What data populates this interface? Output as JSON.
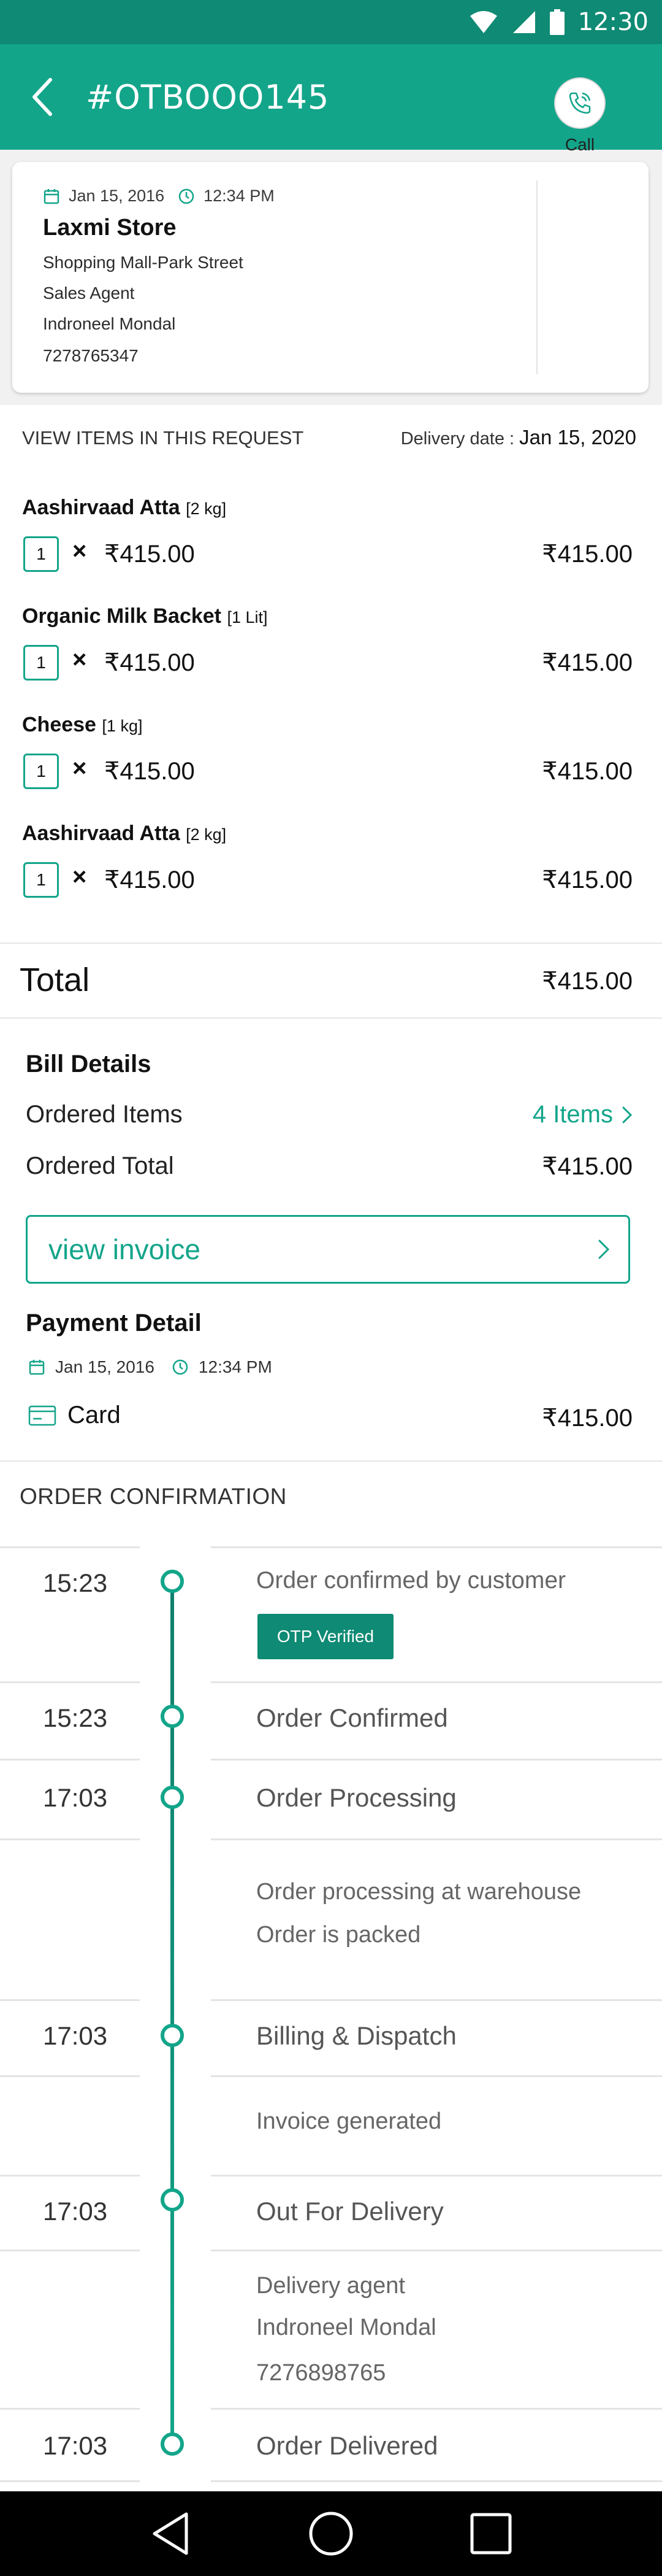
{
  "status_bar": {
    "time": "12:30"
  },
  "header": {
    "title": "#OTBOOO145"
  },
  "store": {
    "date": "Jan 15, 2016",
    "time": "12:34 PM",
    "name": "Laxmi Store",
    "address": "Shopping Mall-Park Street",
    "role": "Sales Agent",
    "agent": "Indroneel Mondal",
    "phone": "7278765347",
    "call_label": "Call"
  },
  "items_section": {
    "heading": "VIEW ITEMS IN THIS REQUEST",
    "delivery_label": "Delivery date :",
    "delivery_date": "Jan 15, 2020"
  },
  "items": [
    {
      "name": "Aashirvaad Atta",
      "size": "[2 kg]",
      "qty": "1",
      "times": "×",
      "unit_price": "₹415.00",
      "line_total": "₹415.00"
    },
    {
      "name": "Organic Milk Backet",
      "size": "[1 Lit]",
      "qty": "1",
      "times": "×",
      "unit_price": "₹415.00",
      "line_total": "₹415.00"
    },
    {
      "name": "Cheese",
      "size": "[1 kg]",
      "qty": "1",
      "times": "×",
      "unit_price": "₹415.00",
      "line_total": "₹415.00"
    },
    {
      "name": "Aashirvaad Atta",
      "size": "[2 kg]",
      "qty": "1",
      "times": "×",
      "unit_price": "₹415.00",
      "line_total": "₹415.00"
    }
  ],
  "total": {
    "label": "Total",
    "value": "₹415.00"
  },
  "bill": {
    "title": "Bill Details",
    "ordered_items_label": "Ordered Items",
    "ordered_items_value": "4 Items",
    "ordered_total_label": "Ordered Total",
    "ordered_total_value": "₹415.00",
    "invoice_button": "view invoice"
  },
  "payment": {
    "title": "Payment Detail",
    "date": "Jan 15, 2016",
    "time": "12:34 PM",
    "method": "Card",
    "amount": "₹415.00"
  },
  "order_confirmation": {
    "title": "ORDER CONFIRMATION",
    "otp_badge": "OTP Verified",
    "steps": [
      {
        "time": "15:23",
        "status": "Order confirmed by customer"
      },
      {
        "time": "15:23",
        "status": "Order Confirmed"
      },
      {
        "time": "17:03",
        "status": "Order Processing",
        "details": [
          "Order processing at warehouse",
          "Order is packed"
        ]
      },
      {
        "time": "17:03",
        "status": "Billing & Dispatch",
        "details": [
          "Invoice generated"
        ]
      },
      {
        "time": "17:03",
        "status": "Out For Delivery",
        "details": [
          "Delivery agent",
          "Indroneel Mondal",
          "7276898765"
        ]
      },
      {
        "time": "17:03",
        "status": "Order Delivered"
      }
    ]
  },
  "colors": {
    "primary": "#13a58a",
    "primary_dark": "#0f8a74"
  },
  "icons": {
    "status": [
      "wifi-icon",
      "signal-icon",
      "battery-icon"
    ],
    "nav": [
      "back-triangle-icon",
      "home-circle-icon",
      "recents-square-icon"
    ]
  }
}
